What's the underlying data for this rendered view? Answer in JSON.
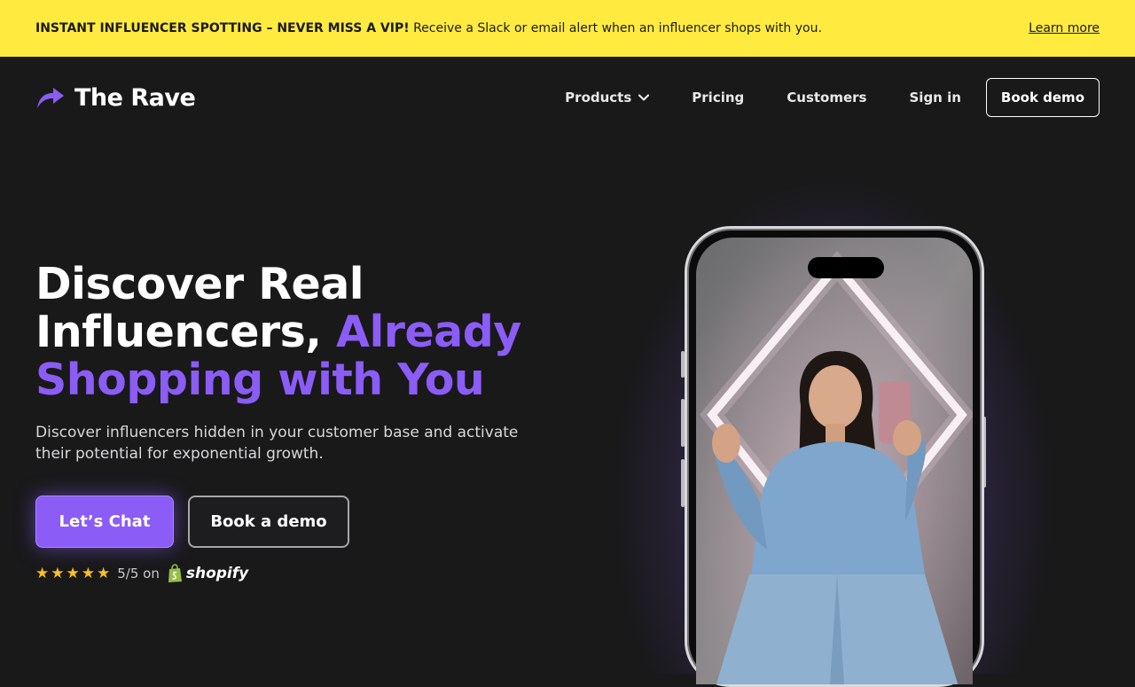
{
  "announcement": {
    "bold": "INSTANT INFLUENCER SPOTTING – NEVER MISS A VIP!",
    "text": " Receive a Slack or email alert when an influencer shops with you.",
    "link": "Learn more"
  },
  "brand": {
    "name": "The Rave",
    "accent": "#8b5cf6"
  },
  "nav": {
    "items": [
      {
        "label": "Products"
      },
      {
        "label": "Pricing"
      },
      {
        "label": "Customers"
      },
      {
        "label": "Sign in"
      }
    ],
    "cta": "Book demo"
  },
  "hero": {
    "line1": "Discover Real",
    "line2_white": "Influencers, ",
    "line2_accent": "Already",
    "line3_accent": "Shopping with You",
    "subtitle": "Discover influencers hidden in your customer base and activate their potential for exponential growth.",
    "primary_cta": "Let’s Chat",
    "secondary_cta": "Book a demo"
  },
  "rating": {
    "stars": 5,
    "text": "5/5 on",
    "platform": "shopify",
    "star_color": "#fbbf24"
  },
  "colors": {
    "banner": "#ffeb3f",
    "background": "#19191a",
    "accent": "#8b5cf6"
  },
  "icons": [
    "logo-arrow-icon",
    "chevron-down-icon",
    "star-icon",
    "shopify-bag-icon"
  ]
}
